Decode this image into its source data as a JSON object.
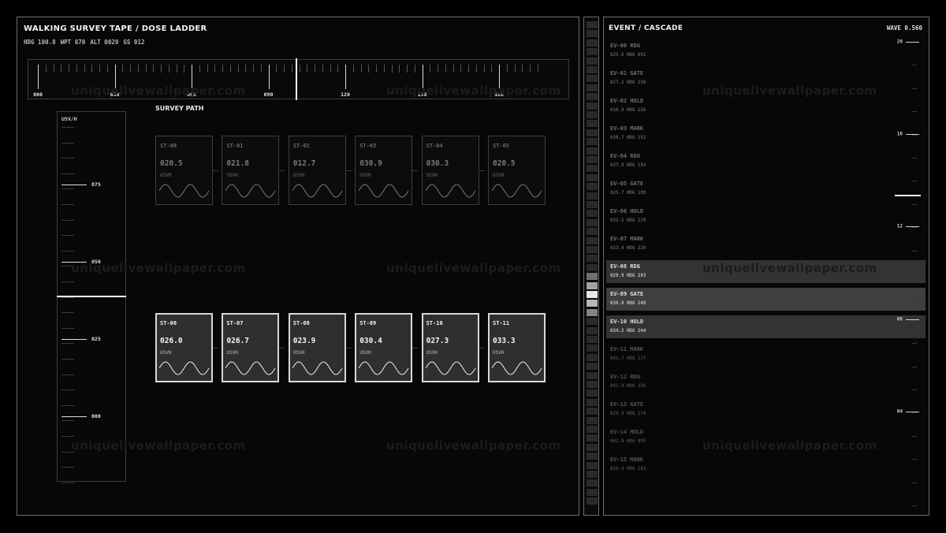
{
  "left": {
    "title": "WALKING SURVEY TAPE / DOSE LADDER",
    "status": [
      {
        "key": "HDG",
        "value": "100.8"
      },
      {
        "key": "WPT",
        "value": "870"
      },
      {
        "key": "ALT",
        "value": "0029"
      },
      {
        "key": "GS",
        "value": "012"
      }
    ],
    "tape_labels": [
      "000",
      "030",
      "060",
      "090",
      "120",
      "150",
      "180"
    ],
    "heading_value": 100.8,
    "ladder_unit": "USV/H",
    "ladder_labels": [
      "075",
      "050",
      "025",
      "000"
    ],
    "dose_value": 39,
    "survey_label": "SURVEY PATH",
    "stations": [
      {
        "id": "ST-00",
        "value": "020.5",
        "unit": "USVH",
        "bright": false
      },
      {
        "id": "ST-01",
        "value": "021.8",
        "unit": "USVH",
        "bright": false
      },
      {
        "id": "ST-02",
        "value": "012.7",
        "unit": "USVH",
        "bright": false
      },
      {
        "id": "ST-03",
        "value": "030.9",
        "unit": "USVH",
        "bright": false
      },
      {
        "id": "ST-04",
        "value": "030.3",
        "unit": "USVH",
        "bright": false
      },
      {
        "id": "ST-05",
        "value": "020.5",
        "unit": "USVH",
        "bright": false
      },
      {
        "id": "ST-06",
        "value": "026.0",
        "unit": "USVH",
        "bright": true
      },
      {
        "id": "ST-07",
        "value": "026.7",
        "unit": "USVH",
        "bright": true
      },
      {
        "id": "ST-08",
        "value": "023.9",
        "unit": "USVH",
        "bright": true
      },
      {
        "id": "ST-09",
        "value": "030.4",
        "unit": "USVH",
        "bright": true
      },
      {
        "id": "ST-10",
        "value": "027.3",
        "unit": "USVH",
        "bright": true
      },
      {
        "id": "ST-11",
        "value": "033.3",
        "unit": "USVH",
        "bright": true
      }
    ]
  },
  "right": {
    "title": "EVENT / CASCADE",
    "wave": "WAVE 0.560",
    "scale_labels": [
      "20",
      "16",
      "12",
      "08",
      "04"
    ],
    "scale_value": 13.4,
    "events": [
      {
        "name": "EV-00 RDG",
        "sub": "025.6  HDG 091",
        "state": "dim"
      },
      {
        "name": "EV-01 GATE",
        "sub": "027.2  HDG 230",
        "state": "dim"
      },
      {
        "name": "EV-02 HOLD",
        "sub": "016.9  HDG 226",
        "state": "dim"
      },
      {
        "name": "EV-03 MARK",
        "sub": "038.7  HDG 152",
        "state": "dim"
      },
      {
        "name": "EV-04 RDG",
        "sub": "037.9  HDG 193",
        "state": "dim"
      },
      {
        "name": "EV-05 GATE",
        "sub": "025.7  HDG 199",
        "state": "dim"
      },
      {
        "name": "EV-06 HOLD",
        "sub": "032.5  HDG 178",
        "state": "dim"
      },
      {
        "name": "EV-07 MARK",
        "sub": "033.4  HDG 226",
        "state": "dim"
      },
      {
        "name": "EV-08 RDG",
        "sub": "029.9  HDG 283",
        "state": "hl"
      },
      {
        "name": "EV-09 GATE",
        "sub": "038.0  HDG 248",
        "state": "hl2"
      },
      {
        "name": "EV-10 HOLD",
        "sub": "034.2  HDG 244",
        "state": "hl"
      },
      {
        "name": "EV-11 MARK",
        "sub": "041.7  HDG 177",
        "state": "faint"
      },
      {
        "name": "EV-12 RDG",
        "sub": "041.0  HDG 250",
        "state": "faint"
      },
      {
        "name": "EV-13 GATE",
        "sub": "029.8  HDG 174",
        "state": "faint"
      },
      {
        "name": "EV-14 HOLD",
        "sub": "042.0  HDG 095",
        "state": "faint"
      },
      {
        "name": "EV-15 MARK",
        "sub": "029.4  HDG 163",
        "state": "faint"
      }
    ]
  },
  "strip_levels": [
    0,
    0,
    0,
    0,
    0,
    0,
    0,
    0,
    0,
    0,
    0,
    0,
    0,
    0,
    0,
    0,
    0,
    0,
    0,
    0,
    0,
    0,
    0,
    0,
    0,
    0,
    0,
    0,
    0.35,
    0.6,
    0.95,
    0.7,
    0.45,
    0,
    0,
    0,
    0,
    0,
    0,
    0,
    0,
    0,
    0,
    0,
    0,
    0,
    0,
    0,
    0,
    0,
    0,
    0,
    0,
    0,
    0
  ],
  "watermark": "uniquelivewallpaper.com"
}
